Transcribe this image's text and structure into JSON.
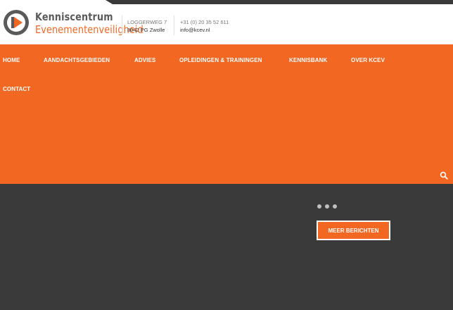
{
  "brand": {
    "line1": "Kenniscentrum",
    "line2": "Evenementenveiligheid"
  },
  "contact": {
    "address_line1": "LOGGERWEG 7",
    "address_line2": "8042 PG Zwolle",
    "phone": "+31 (0) 20 35 52 611",
    "email": "info@kcev.nl"
  },
  "nav": {
    "items": [
      {
        "label": "HOME"
      },
      {
        "label": "AANDACHTSGEBIEDEN"
      },
      {
        "label": "ADVIES"
      },
      {
        "label": "OPLEIDINGEN & TRAININGEN"
      },
      {
        "label": "KENNISBANK"
      },
      {
        "label": "OVER KCEV"
      },
      {
        "label": "CONTACT"
      }
    ]
  },
  "slider": {
    "dots": 3
  },
  "more_button": {
    "label": "MEER BERICHTEN"
  },
  "colors": {
    "accent": "#f26722",
    "dark": "#3a3a3a",
    "logo_gray": "#5a5a5a"
  },
  "icons": {
    "logo": "play-triangle-logo",
    "search": "search-icon"
  }
}
